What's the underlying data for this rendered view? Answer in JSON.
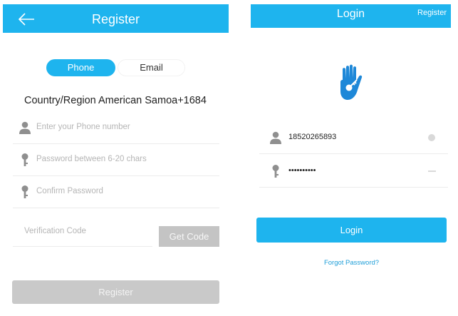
{
  "register_screen": {
    "header": {
      "title": "Register",
      "back_icon": "arrow-left-icon"
    },
    "toggle": {
      "phone_label": "Phone",
      "email_label": "Email",
      "selected": "Phone"
    },
    "country_region": {
      "label": "Country/Region",
      "value": "American Samoa+1684"
    },
    "phone_field": {
      "placeholder": "Enter your Phone number",
      "icon": "user-icon"
    },
    "password_field": {
      "placeholder": "Password between 6-20 chars",
      "icon": "key-icon"
    },
    "confirm_field": {
      "placeholder": "Confirm Password",
      "icon": "key-icon"
    },
    "verification_field": {
      "placeholder": "Verification Code"
    },
    "get_code_label": "Get Code",
    "register_button_label": "Register"
  },
  "login_screen": {
    "header": {
      "title": "Login",
      "register_link": "Register"
    },
    "logo_icon": "hand-key-icon",
    "username_field": {
      "value": "18520265893",
      "icon": "user-icon"
    },
    "password_field": {
      "value": "••••••••••",
      "icon": "key-icon"
    },
    "login_button_label": "Login",
    "forgot_link": "Forgot Password?"
  },
  "colors": {
    "accent": "#1eb4ee",
    "disabled": "#c9c9c9",
    "link": "#1e9ed8"
  }
}
